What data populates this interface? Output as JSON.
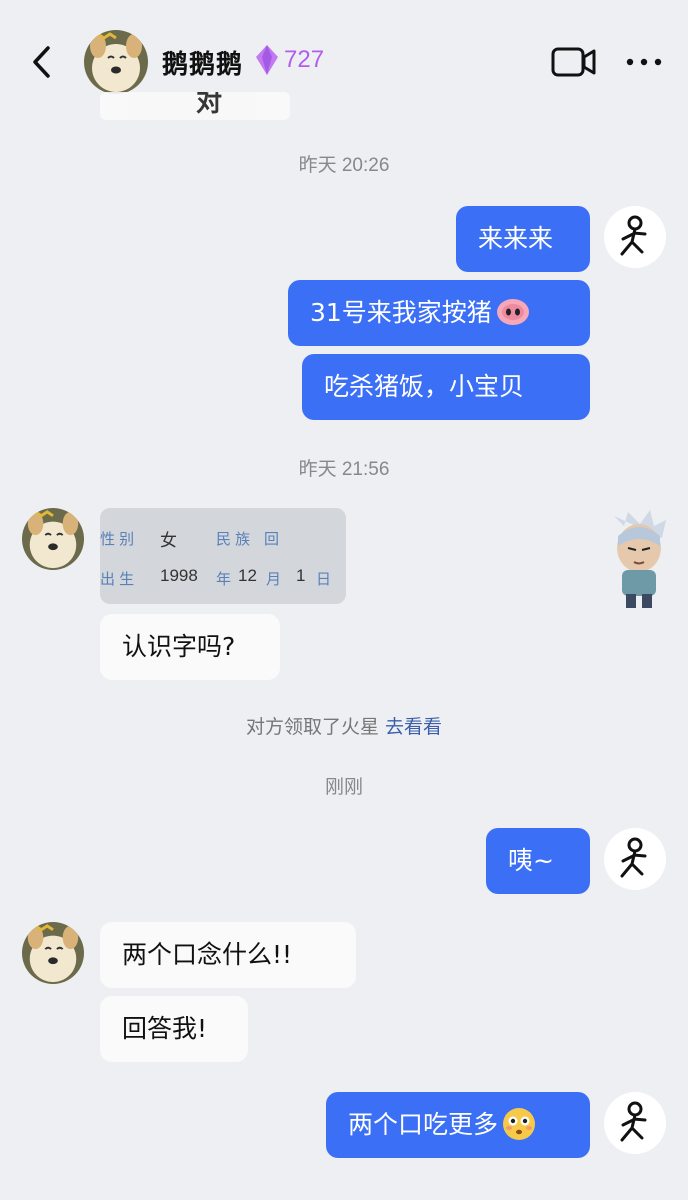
{
  "header": {
    "contact_name": "鹅鹅鹅",
    "score": "727",
    "accent_color": "#b15df0",
    "icons": [
      "back-arrow-icon",
      "gem-icon",
      "video-call-icon",
      "more-icon"
    ]
  },
  "previous_message_fragment": "对",
  "timestamps": {
    "t1": "昨天 20:26",
    "t2": "昨天 21:56",
    "t3": "刚刚"
  },
  "messages": {
    "out1": "来来来",
    "out2": "31号来我家按猪",
    "out3": "吃杀猪饭，小宝贝",
    "in_question": "认识字吗?",
    "out4": "咦~",
    "in2": "两个口念什么!!",
    "in3": "回答我!",
    "out5": "两个口吃更多"
  },
  "id_card": {
    "gender_label": "性 别",
    "gender_value": "女",
    "ethnicity_label": "民 族",
    "ethnicity_value": "回",
    "birth_label": "出 生",
    "birth_year": "1998",
    "year_char": "年",
    "birth_month": "12",
    "month_char": "月",
    "birth_day": "1",
    "day_char": "日"
  },
  "system_notice": {
    "text": "对方领取了火星",
    "link": "去看看"
  },
  "colors": {
    "outgoing_bubble": "#3b6ff5",
    "incoming_bubble": "#fafafa",
    "background": "#eeeff3"
  }
}
